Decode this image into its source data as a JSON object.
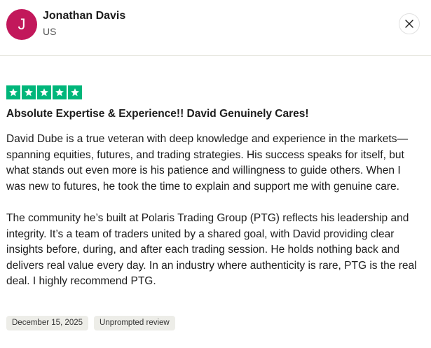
{
  "reviewer": {
    "initial": "J",
    "name": "Jonathan Davis",
    "country": "US",
    "avatar_color": "#c2185b"
  },
  "review": {
    "rating": 5,
    "rating_max": 5,
    "star_color": "#00b67a",
    "title": "Absolute Expertise & Experience!! David Genuinely Cares!",
    "paragraphs": [
      "David Dube is a true veteran with deep knowledge and experience in the markets—spanning equities, futures, and trading strategies. His success speaks for itself, but what stands out even more is his patience and willingness to guide others. When I was new to futures, he took the time to explain and support me with genuine care.",
      "The community he’s built at Polaris Trading Group (PTG) reflects his leadership and integrity. It’s a team of traders united by a shared goal, with David providing clear insights before, during, and after each trading session. He holds nothing back and delivers real value every day. In an industry where authenticity is rare, PTG is the real deal. I highly recommend PTG."
    ],
    "date": "December 15, 2025",
    "tag": "Unprompted review"
  },
  "icons": {
    "close": "close-icon",
    "star": "star-icon"
  }
}
